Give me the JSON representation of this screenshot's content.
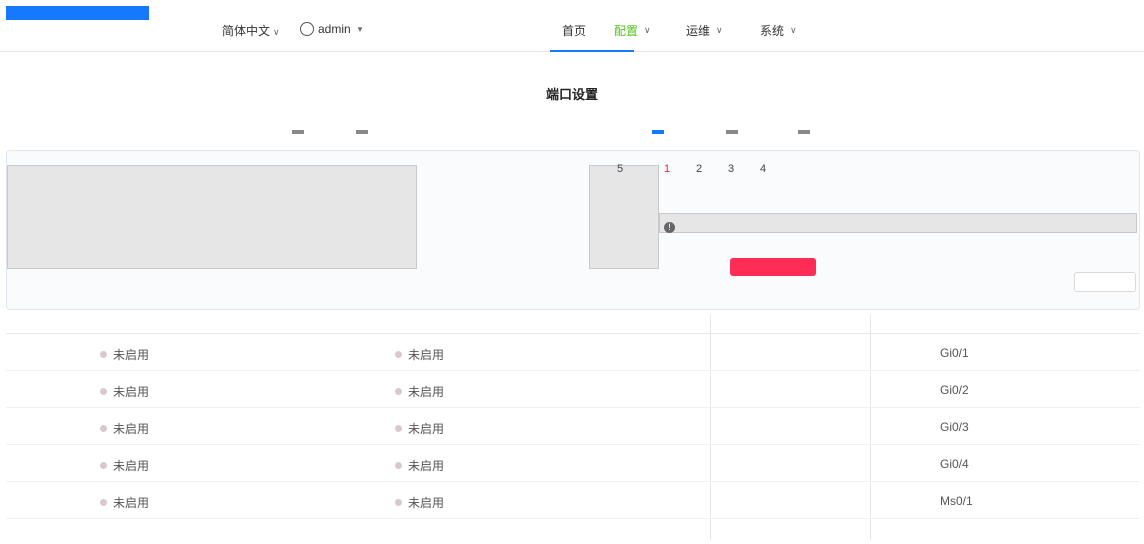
{
  "header": {
    "language": "简体中文",
    "user": "admin",
    "nav": [
      {
        "label": "首页",
        "active": false,
        "dropdown": false
      },
      {
        "label": "配置",
        "active": true,
        "dropdown": true
      },
      {
        "label": "运维",
        "active": false,
        "dropdown": true
      },
      {
        "label": "系统",
        "active": false,
        "dropdown": true
      }
    ],
    "colors": {
      "logo": "#1677ff",
      "active_nav": "#52c41a",
      "primary": "#1677ff",
      "apply_button": "#ff2d55"
    }
  },
  "page": {
    "title": "端口设置"
  },
  "device": {
    "port_numbers": [
      "5",
      "1",
      "2",
      "3",
      "4"
    ],
    "selected_port": "1"
  },
  "table": {
    "rows": [
      {
        "status_a": "未启用",
        "status_b": "未启用",
        "port": "Gi0/1"
      },
      {
        "status_a": "未启用",
        "status_b": "未启用",
        "port": "Gi0/2"
      },
      {
        "status_a": "未启用",
        "status_b": "未启用",
        "port": "Gi0/3"
      },
      {
        "status_a": "未启用",
        "status_b": "未启用",
        "port": "Gi0/4"
      },
      {
        "status_a": "未启用",
        "status_b": "未启用",
        "port": "Ms0/1"
      }
    ]
  }
}
